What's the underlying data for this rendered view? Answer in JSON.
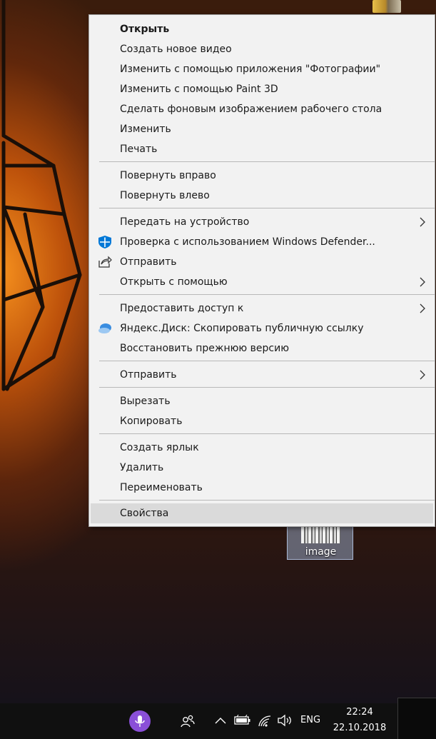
{
  "desktop": {
    "icon_label": "image"
  },
  "context_menu": {
    "items": [
      {
        "label": "Открыть",
        "bold": true
      },
      {
        "label": "Создать новое видео"
      },
      {
        "label": "Изменить с помощью приложения \"Фотографии\""
      },
      {
        "label": "Изменить с помощью Paint 3D"
      },
      {
        "label": "Сделать фоновым изображением рабочего стола"
      },
      {
        "label": "Изменить"
      },
      {
        "label": "Печать"
      },
      {
        "label": "Повернуть вправо"
      },
      {
        "label": "Повернуть влево"
      },
      {
        "label": "Передать на устройство",
        "submenu": true
      },
      {
        "label": "Проверка с использованием Windows Defender...",
        "icon": "windows-defender-icon"
      },
      {
        "label": "Отправить",
        "icon": "share-icon"
      },
      {
        "label": "Открыть с помощью",
        "submenu": true
      },
      {
        "label": "Предоставить доступ к",
        "submenu": true
      },
      {
        "label": "Яндекс.Диск: Скопировать публичную ссылку",
        "icon": "yandex-disk-icon"
      },
      {
        "label": "Восстановить прежнюю версию"
      },
      {
        "label": "Отправить",
        "submenu": true
      },
      {
        "label": "Вырезать"
      },
      {
        "label": "Копировать"
      },
      {
        "label": "Создать ярлык"
      },
      {
        "label": "Удалить"
      },
      {
        "label": "Переименовать"
      },
      {
        "label": "Свойства",
        "highlighted": true
      }
    ]
  },
  "taskbar": {
    "language": "ENG",
    "time": "22:24",
    "date": "22.10.2018",
    "icons": [
      "cortana-microphone-icon",
      "people-icon",
      "chevron-up-icon",
      "battery-icon",
      "wifi-icon",
      "volume-icon"
    ]
  },
  "colors": {
    "menu_background": "#f2f2f2",
    "menu_highlight": "#dadada",
    "taskbar": "#101010",
    "cortana": "#8a4fd8",
    "defender_blue": "#0078d7"
  }
}
